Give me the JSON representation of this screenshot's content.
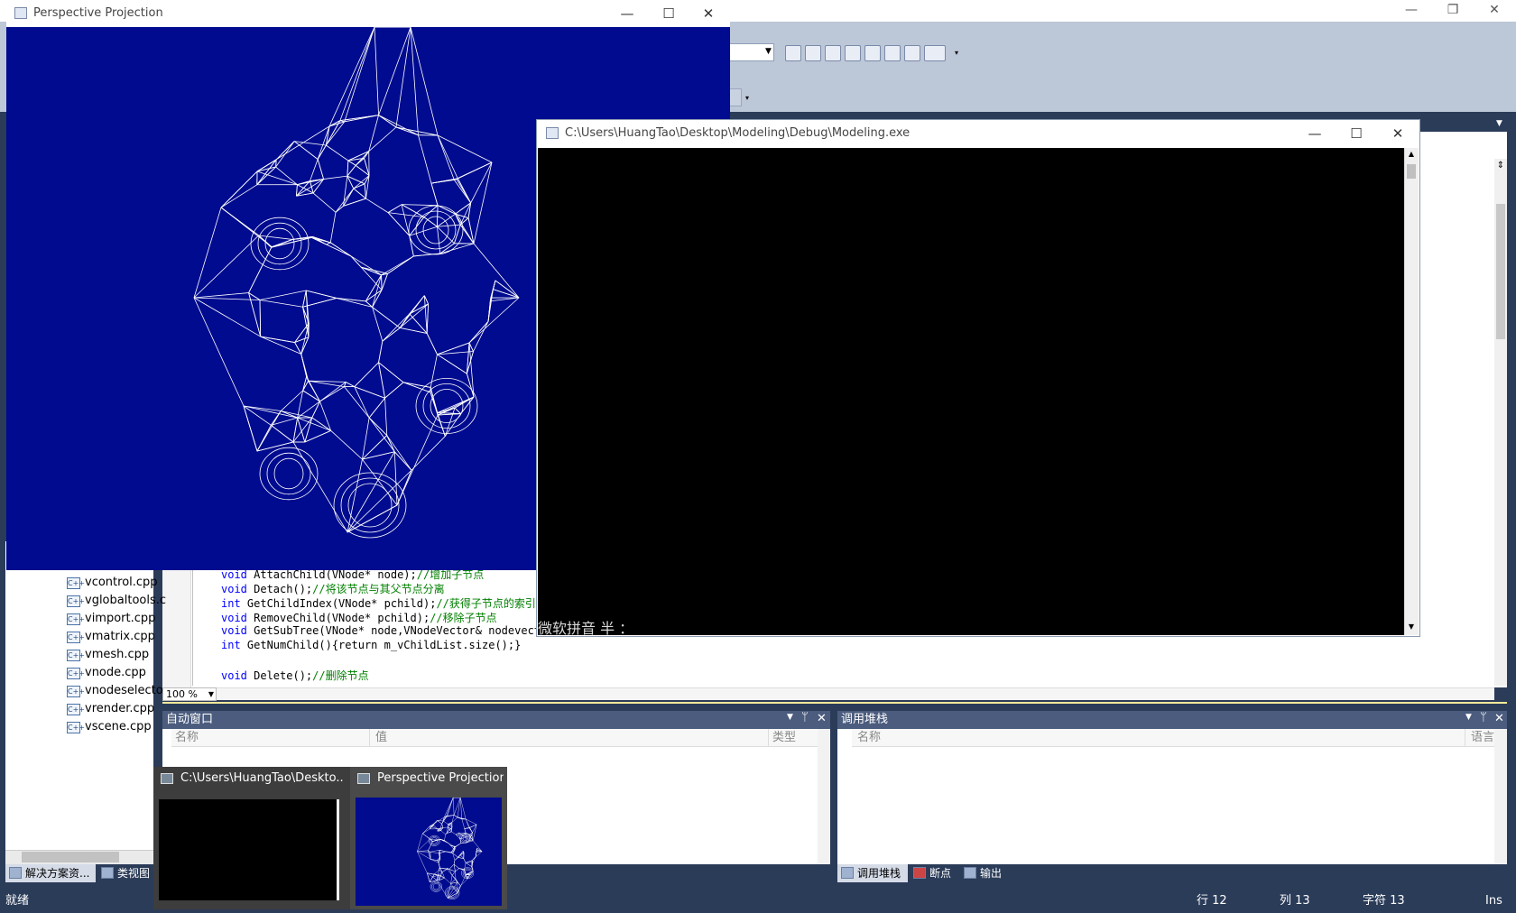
{
  "ide": {
    "window_controls": [
      "—",
      "❐",
      "✕"
    ],
    "zoom": "100 %",
    "code_lines": [
      {
        "type": "void",
        "sig": " AttachChild(VNode* node);",
        "comment": "//增加子节点"
      },
      {
        "type": "void",
        "sig": " Detach();",
        "comment": "//将该节点与其父节点分离"
      },
      {
        "type": "int",
        "sig": " GetChildIndex(VNode* pchild);",
        "comment": "//获得子节点的索引"
      },
      {
        "type": "void",
        "sig": " RemoveChild(VNode* pchild);",
        "comment": "//移除子节点"
      },
      {
        "type": "void",
        "sig": " GetSubTree(VNode* node,VNodeVector& nodevecto",
        "comment": ""
      },
      {
        "type": "int",
        "sig": " GetNumChild(){return m_vChildList.size();}",
        "comment": ""
      },
      {
        "type": "",
        "sig": "",
        "comment": ""
      },
      {
        "type": "void",
        "sig": " Delete();",
        "comment": "//删除节点"
      }
    ]
  },
  "solution_explorer": {
    "files": [
      "vcontrol.cpp",
      "vglobaltools.c",
      "vimport.cpp",
      "vmatrix.cpp",
      "vmesh.cpp",
      "vnode.cpp",
      "vnodeselecto",
      "vrender.cpp",
      "vscene.cpp"
    ],
    "tabs": [
      "解决方案资...",
      "类视图"
    ]
  },
  "auto_window": {
    "title": "自动窗口",
    "columns": [
      "名称",
      "值",
      "类型"
    ]
  },
  "call_stack": {
    "title": "调用堆栈",
    "columns": [
      "名称",
      "语言"
    ],
    "tabs": [
      "调用堆栈",
      "断点",
      "输出"
    ]
  },
  "status_bar": {
    "ready": "就绪",
    "line": "行 12",
    "col": "列 13",
    "char": "字符 13",
    "mode": "Ins"
  },
  "perspective_window": {
    "title": "Perspective Projection",
    "controls": [
      "—",
      "☐",
      "✕"
    ]
  },
  "console_window": {
    "title": "C:\\Users\\HuangTao\\Desktop\\Modeling\\Debug\\Modeling.exe",
    "controls": [
      "—",
      "☐",
      "✕"
    ],
    "ime_text": "微软拼音 半 ："
  },
  "taskbar_thumbnails": [
    {
      "title": "C:\\Users\\HuangTao\\Deskto...",
      "kind": "console"
    },
    {
      "title": "Perspective Projection",
      "kind": "wireframe"
    }
  ],
  "colors": {
    "ide_dark": "#2b3c59",
    "perspective_bg": "#000b8f",
    "console_bg": "#000000",
    "keyword": "#0000ff",
    "comment": "#008000"
  }
}
